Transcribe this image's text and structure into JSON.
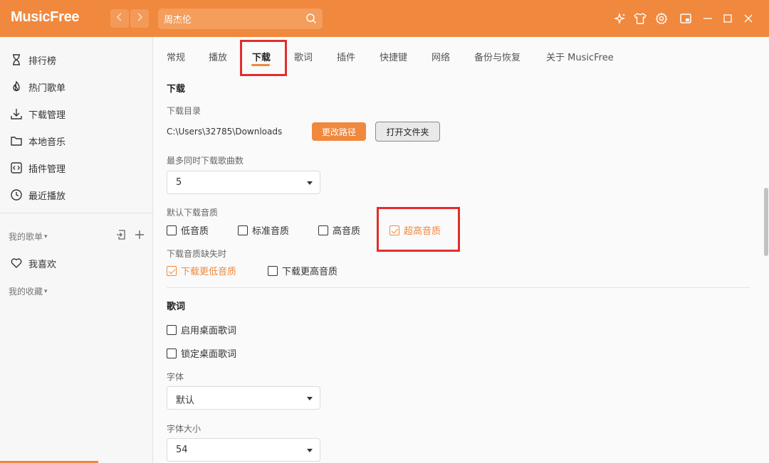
{
  "app": {
    "title": "MusicFree"
  },
  "search": {
    "value": "周杰伦"
  },
  "sidebar": {
    "items": [
      {
        "label": "排行榜"
      },
      {
        "label": "热门歌单"
      },
      {
        "label": "下载管理"
      },
      {
        "label": "本地音乐"
      },
      {
        "label": "插件管理"
      },
      {
        "label": "最近播放"
      }
    ],
    "my_playlists": "我的歌单",
    "favorite": "我喜欢",
    "my_collections": "我的收藏"
  },
  "tabs": [
    {
      "label": "常规"
    },
    {
      "label": "播放"
    },
    {
      "label": "下载"
    },
    {
      "label": "歌词"
    },
    {
      "label": "插件"
    },
    {
      "label": "快捷键"
    },
    {
      "label": "网络"
    },
    {
      "label": "备份与恢复"
    },
    {
      "label": "关于 MusicFree"
    }
  ],
  "download": {
    "title": "下载",
    "dir_label": "下载目录",
    "path": "C:\\Users\\32785\\Downloads",
    "change_path": "更改路径",
    "open_folder": "打开文件夹",
    "max_concurrent_label": "最多同时下载歌曲数",
    "max_concurrent_value": "5",
    "quality_label": "默认下载音质",
    "qualities": [
      {
        "label": "低音质",
        "checked": false
      },
      {
        "label": "标准音质",
        "checked": false
      },
      {
        "label": "高音质",
        "checked": false
      },
      {
        "label": "超高音质",
        "checked": true
      }
    ],
    "missing_label": "下载音质缺失时",
    "missing_options": [
      {
        "label": "下载更低音质",
        "checked": true
      },
      {
        "label": "下载更高音质",
        "checked": false
      }
    ]
  },
  "lyrics": {
    "title": "歌词",
    "desktop_enable": "启用桌面歌词",
    "desktop_lock": "锁定桌面歌词",
    "font_label": "字体",
    "font_value": "默认",
    "font_size_label": "字体大小",
    "font_size_value": "54"
  },
  "colors": {
    "accent": "#f0883e",
    "highlight": "#e32d2d"
  }
}
